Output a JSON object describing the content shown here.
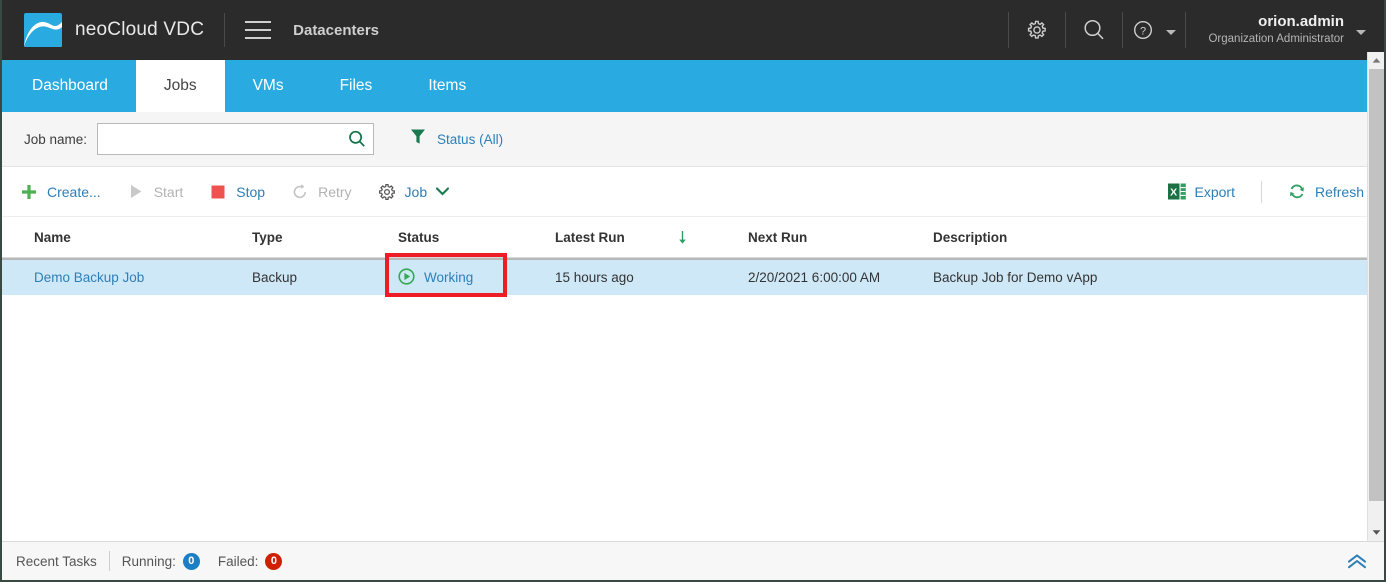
{
  "header": {
    "brand": "neoCloud VDC",
    "breadcrumb": "Datacenters",
    "menu_icon": "hamburger-icon",
    "settings_icon": "gear-icon",
    "search_icon": "search-icon",
    "help_icon": "help-circle-icon",
    "user_name": "orion.admin",
    "user_role": "Organization Administrator",
    "accent": "#29abe2",
    "background": "#2b2b2b"
  },
  "tabs": [
    {
      "label": "Dashboard",
      "active": false
    },
    {
      "label": "Jobs",
      "active": true
    },
    {
      "label": "VMs",
      "active": false
    },
    {
      "label": "Files",
      "active": false
    },
    {
      "label": "Items",
      "active": false
    }
  ],
  "filter_bar": {
    "job_name_label": "Job name:",
    "job_name_value": "",
    "job_name_placeholder": "",
    "search_icon": "search-icon",
    "status_filter_label": "Status (All)",
    "filter_icon": "funnel-icon"
  },
  "toolbar": {
    "create_label": "Create...",
    "start_label": "Start",
    "stop_label": "Stop",
    "retry_label": "Retry",
    "job_label": "Job",
    "export_label": "Export",
    "refresh_label": "Refresh",
    "create_enabled": true,
    "start_enabled": false,
    "stop_enabled": true,
    "retry_enabled": false
  },
  "table": {
    "columns": [
      {
        "key": "name",
        "label": "Name"
      },
      {
        "key": "type",
        "label": "Type"
      },
      {
        "key": "status",
        "label": "Status"
      },
      {
        "key": "latest",
        "label": "Latest Run"
      },
      {
        "key": "next",
        "label": "Next Run"
      },
      {
        "key": "desc",
        "label": "Description"
      }
    ],
    "sorted_column": "latest",
    "sort_direction": "desc",
    "rows": [
      {
        "name": "Demo Backup Job",
        "type": "Backup",
        "status": "Working",
        "status_icon": "play-circle-icon",
        "latest": "15 hours ago",
        "next": "2/20/2021 6:00:00 AM",
        "desc": "Backup Job for Demo vApp",
        "selected": true
      }
    ]
  },
  "annotation": {
    "color": "#ee1c25",
    "target": "status-cell"
  },
  "status_bar": {
    "recent_tasks_label": "Recent Tasks",
    "running_label": "Running:",
    "running_count": "0",
    "failed_label": "Failed:",
    "failed_count": "0",
    "expand_icon": "double-chevron-up-icon",
    "running_badge_color": "#1b7fc3",
    "failed_badge_color": "#cc2200"
  },
  "scrollbar": {
    "up_icon": "caret-up-icon",
    "down_icon": "caret-down-icon"
  }
}
